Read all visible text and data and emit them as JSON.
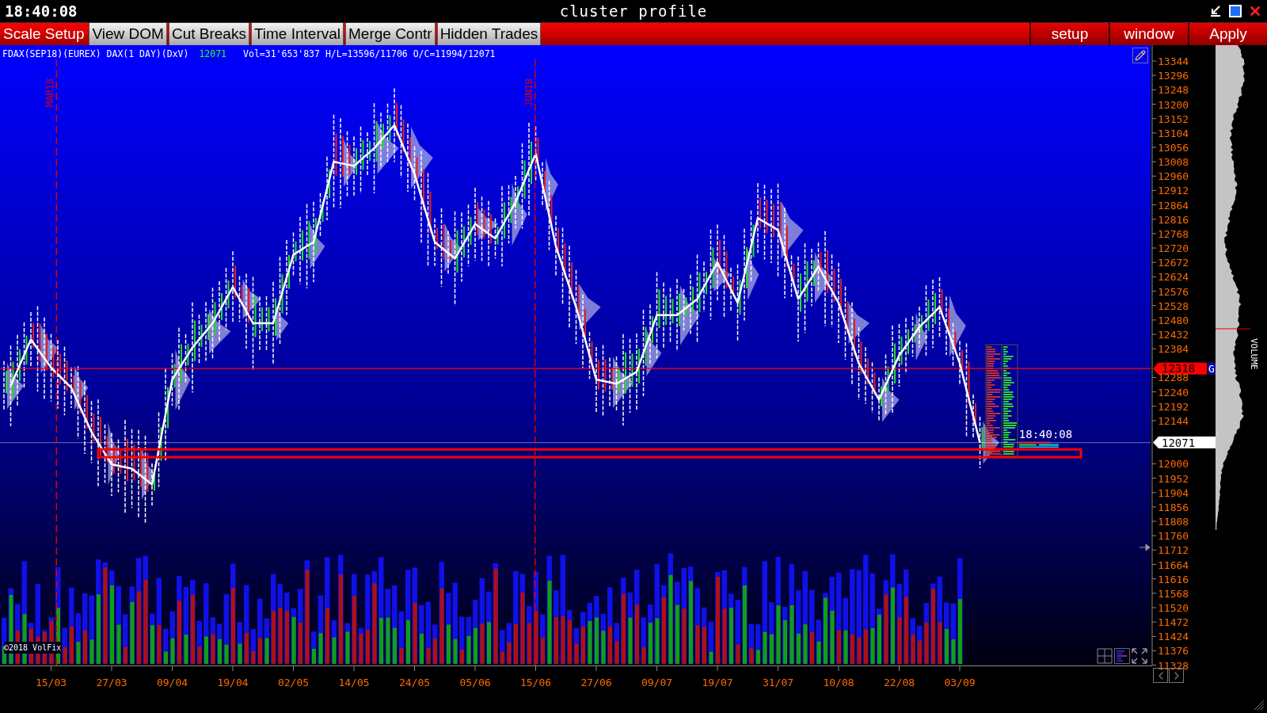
{
  "window": {
    "clock": "18:40:08",
    "title": "cluster profile",
    "controls": [
      {
        "kind": "minimize"
      },
      {
        "kind": "restore"
      },
      {
        "kind": "close"
      }
    ]
  },
  "toolbar": {
    "tabs": [
      {
        "label": "Scale Setup",
        "selected": true
      },
      {
        "label": "View DOM",
        "selected": false
      },
      {
        "label": "Cut Breaks",
        "selected": false
      },
      {
        "label": "Time Interval",
        "selected": false
      },
      {
        "label": "Merge Contr",
        "selected": false
      },
      {
        "label": "Hidden Trades",
        "selected": false
      }
    ],
    "buttons": [
      "setup",
      "window",
      "Apply"
    ]
  },
  "chart": {
    "info": {
      "symbol": "FDAX(SEP18)(EUREX) DAX(1 DAY)(DxV)",
      "last": "12071",
      "stats": "Vol=31'653'837 H/L=13596/11706 O/C=11994/12071"
    },
    "copyright": "©2018 VolFix",
    "volume_label": "VOLUME",
    "roll_labels": [
      "MAR18",
      "JUN18"
    ],
    "time_label": "18:40:08",
    "chart_data": {
      "type": "line",
      "categories": [
        null,
        null,
        "15/03",
        null,
        null,
        "27/03",
        null,
        null,
        "09/04",
        null,
        null,
        "19/04",
        null,
        null,
        "02/05",
        null,
        null,
        "14/05",
        null,
        null,
        "24/05",
        null,
        null,
        "05/06",
        null,
        null,
        "15/06",
        null,
        null,
        "27/06",
        null,
        null,
        "09/07",
        null,
        null,
        "19/07",
        null,
        null,
        "31/07",
        null,
        null,
        "10/08",
        null,
        null,
        "22/08",
        null,
        null,
        "03/09",
        null
      ],
      "series": [
        {
          "color": "#ffffff",
          "values": [
            12260,
            12415,
            12321,
            12254,
            12106,
            11998,
            11984,
            11931,
            12281,
            12388,
            12469,
            12590,
            12469,
            12469,
            12698,
            12740,
            13008,
            12994,
            13053,
            13130,
            12967,
            12740,
            12685,
            12800,
            12752,
            12873,
            13035,
            12726,
            12523,
            12281,
            12267,
            12307,
            12496,
            12496,
            12550,
            12672,
            12537,
            12820,
            12780,
            12550,
            12658,
            12537,
            12335,
            12214,
            12362,
            12456,
            12523,
            12335,
            12071
          ]
        }
      ],
      "ylim": [
        11327,
        13397
      ],
      "yticks": [
        11328,
        11376,
        11424,
        11472,
        11520,
        11568,
        11616,
        11664,
        11712,
        11760,
        11808,
        11856,
        11904,
        11952,
        12000,
        12144,
        12192,
        12240,
        12288,
        12384,
        12432,
        12480,
        12528,
        12576,
        12624,
        12672,
        12720,
        12768,
        12816,
        12864,
        12912,
        12960,
        13008,
        13056,
        13104,
        13152,
        13200,
        13248,
        13296,
        13344
      ]
    },
    "price_tags": [
      {
        "label": "12318",
        "badge": "G",
        "color": "#ff0000"
      },
      {
        "label": "12071",
        "color": "#ffffff"
      }
    ]
  }
}
